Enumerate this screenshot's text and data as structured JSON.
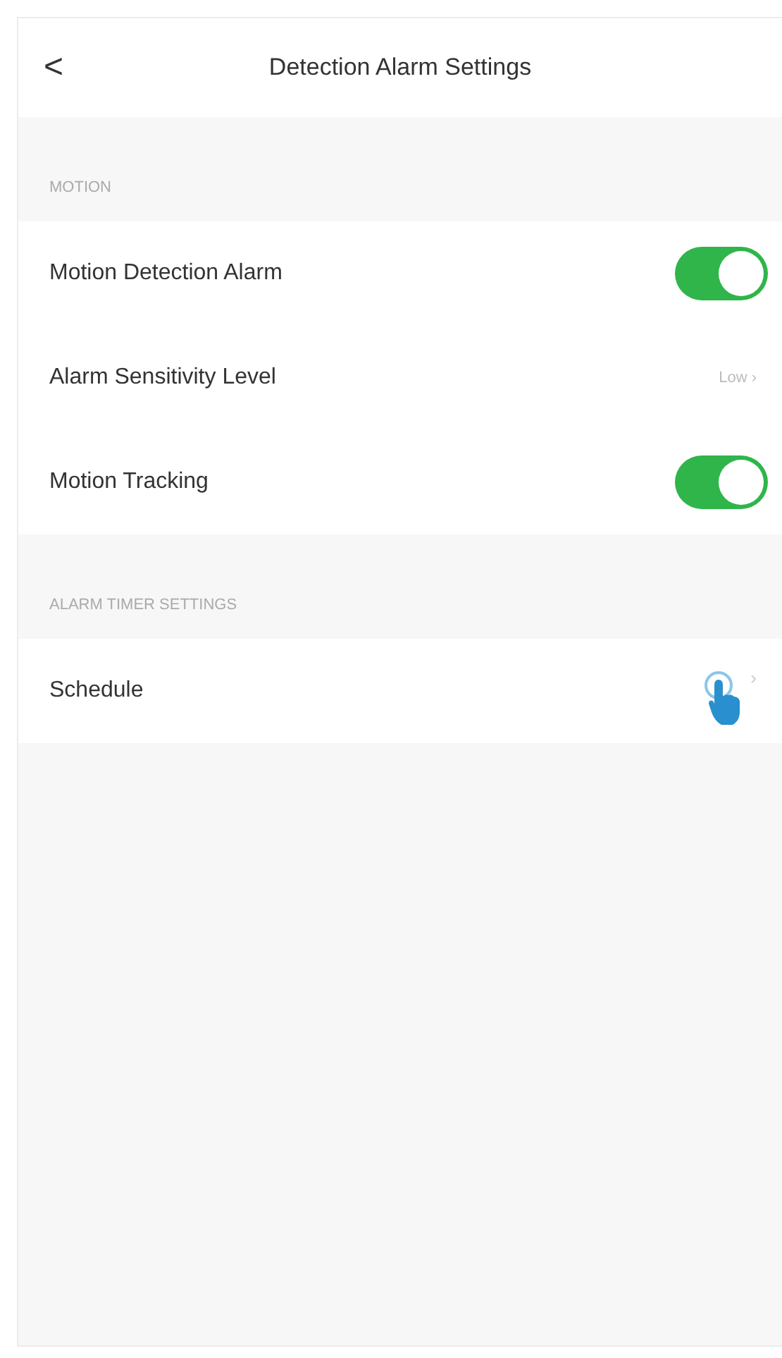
{
  "header": {
    "back": "<",
    "title": "Detection Alarm Settings"
  },
  "sections": [
    {
      "title": "MOTION",
      "rows": [
        {
          "kind": "toggle",
          "label": "Motion Detection Alarm",
          "on": true
        },
        {
          "kind": "value",
          "label": "Alarm Sensitivity Level",
          "value": "Low",
          "chevron": "›"
        },
        {
          "kind": "toggle",
          "label": "Motion Tracking",
          "on": true
        }
      ]
    },
    {
      "title": "ALARM TIMER SETTINGS",
      "rows": [
        {
          "kind": "link",
          "label": "Schedule",
          "chevron": "›"
        }
      ]
    }
  ]
}
